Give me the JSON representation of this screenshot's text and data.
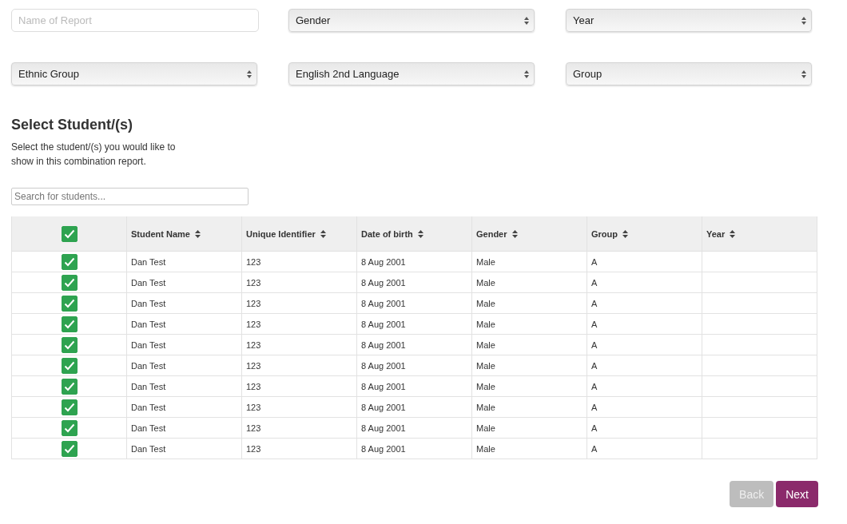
{
  "filters": [
    {
      "kind": "input",
      "placeholder": "Name of Report"
    },
    {
      "kind": "select",
      "value": "Gender"
    },
    {
      "kind": "select",
      "value": "Year"
    },
    {
      "kind": "select",
      "value": "Ethnic Group"
    },
    {
      "kind": "select",
      "value": "English 2nd Language"
    },
    {
      "kind": "select",
      "value": "Group"
    }
  ],
  "section": {
    "title": "Select Student/(s)",
    "description": "Select the student/(s) you would like to show in this combination report."
  },
  "search": {
    "placeholder": "Search for students..."
  },
  "table": {
    "select_all": {
      "checked": true
    },
    "columns": [
      "Student Name",
      "Unique Identifier",
      "Date of birth",
      "Gender",
      "Group",
      "Year"
    ],
    "rows": [
      {
        "checked": true,
        "cells": [
          "Dan Test",
          "123",
          "8 Aug 2001",
          "Male",
          "A"
        ]
      },
      {
        "checked": true,
        "cells": [
          "Dan Test",
          "123",
          "8 Aug 2001",
          "Male",
          "A"
        ]
      },
      {
        "checked": true,
        "cells": [
          "Dan Test",
          "123",
          "8 Aug 2001",
          "Male",
          "A"
        ]
      },
      {
        "checked": true,
        "cells": [
          "Dan Test",
          "123",
          "8 Aug 2001",
          "Male",
          "A"
        ]
      },
      {
        "checked": true,
        "cells": [
          "Dan Test",
          "123",
          "8 Aug 2001",
          "Male",
          "A"
        ]
      },
      {
        "checked": true,
        "cells": [
          "Dan Test",
          "123",
          "8 Aug 2001",
          "Male",
          "A"
        ]
      },
      {
        "checked": true,
        "cells": [
          "Dan Test",
          "123",
          "8 Aug 2001",
          "Male",
          "A"
        ]
      },
      {
        "checked": true,
        "cells": [
          "Dan Test",
          "123",
          "8 Aug 2001",
          "Male",
          "A"
        ]
      },
      {
        "checked": true,
        "cells": [
          "Dan Test",
          "123",
          "8 Aug 2001",
          "Male",
          "A"
        ]
      },
      {
        "checked": true,
        "cells": [
          "Dan Test",
          "123",
          "8 Aug 2001",
          "Male",
          "A"
        ]
      }
    ]
  },
  "buttons": [
    {
      "label": "Back",
      "disabled": true
    },
    {
      "label": "Next",
      "disabled": false
    }
  ]
}
